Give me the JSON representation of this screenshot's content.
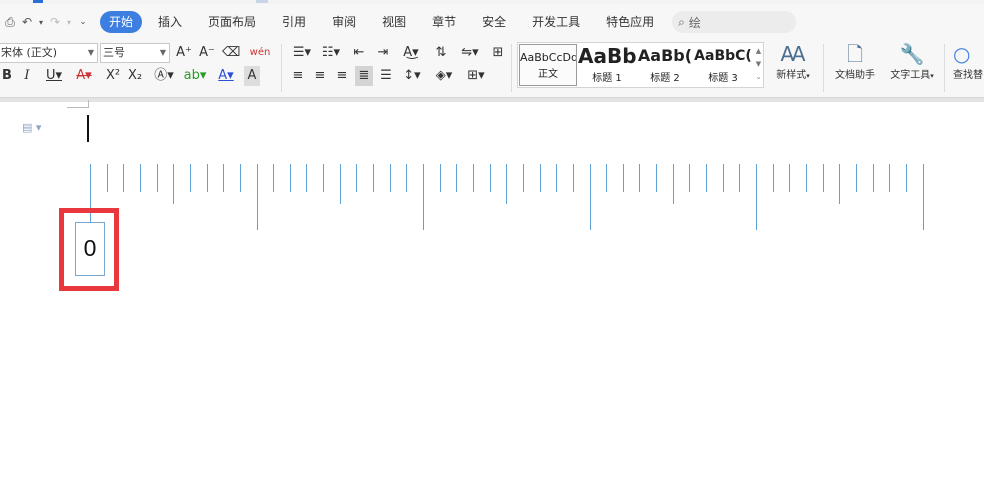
{
  "menu": {
    "tabs": [
      "开始",
      "插入",
      "页面布局",
      "引用",
      "审阅",
      "视图",
      "章节",
      "安全",
      "开发工具",
      "特色应用"
    ],
    "search_placeholder": "绘"
  },
  "ribbon": {
    "font_name": "宋体 (正文)",
    "font_size": "三号",
    "styles": [
      {
        "preview": "AaBbCcDd",
        "name": "正文"
      },
      {
        "preview": "AaBb",
        "name": "标题 1"
      },
      {
        "preview": "AaBb(",
        "name": "标题 2"
      },
      {
        "preview": "AaBbC(",
        "name": "标题 3"
      }
    ],
    "new_style": "新样式",
    "doc_assistant": "文档助手",
    "text_tools": "文字工具",
    "find": "查找替"
  },
  "document": {
    "zero_label": "0"
  },
  "colors": {
    "accent": "#3d7fe0",
    "highlight_box": "#e8383d",
    "ruler_tick": "#5fa3d6"
  }
}
